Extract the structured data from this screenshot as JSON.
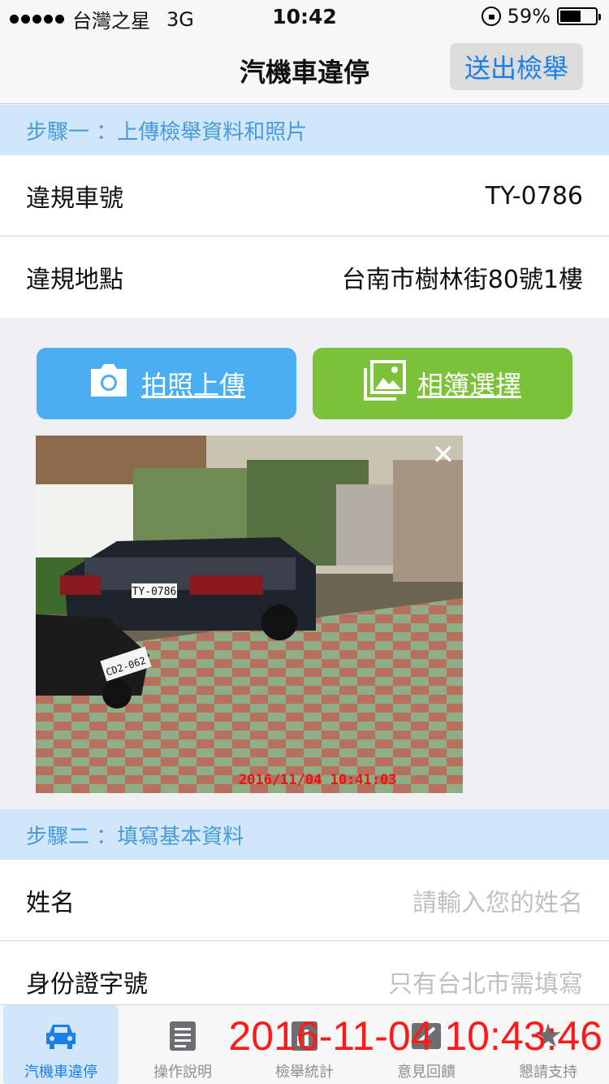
{
  "status": {
    "carrier": "台灣之星",
    "network": "3G",
    "time": "10:42",
    "battery": "59%",
    "battery_level": 0.59
  },
  "nav": {
    "title": "汽機車違停",
    "action": "送出檢舉"
  },
  "step1": {
    "header": "步驟一 ：上傳檢舉資料和照片",
    "plate_label": "違規車號",
    "plate_value": "TY-0786",
    "location_label": "違規地點",
    "location_value": "台南市樹林街80號1樓",
    "camera_button": "拍照上傳",
    "album_button": "相簿選擇",
    "photo": {
      "plate_text": "TY-0786",
      "scooter_plate": "CD2-062",
      "timestamp": "2016/11/04 10:41:03"
    }
  },
  "step2": {
    "header": "步驟二 ：填寫基本資料",
    "name_label": "姓名",
    "name_placeholder": "請輸入您的姓名",
    "id_label": "身份證字號",
    "id_placeholder": "只有台北市需填寫"
  },
  "tabs": [
    {
      "label": "汽機車違停",
      "icon": "car-icon",
      "active": true
    },
    {
      "label": "操作說明",
      "icon": "document-icon"
    },
    {
      "label": "檢舉統計",
      "icon": "chart-icon"
    },
    {
      "label": "意見回饋",
      "icon": "feedback-icon"
    },
    {
      "label": "懇請支持",
      "icon": "star-icon"
    }
  ],
  "overlay_timestamp": "2016-11-04 10:43:46",
  "colors": {
    "accent": "#1a7fe6",
    "section": "#cfe6fb",
    "camera": "#4aaef0",
    "album": "#7cc13a",
    "stamp": "#ff1a1a"
  }
}
